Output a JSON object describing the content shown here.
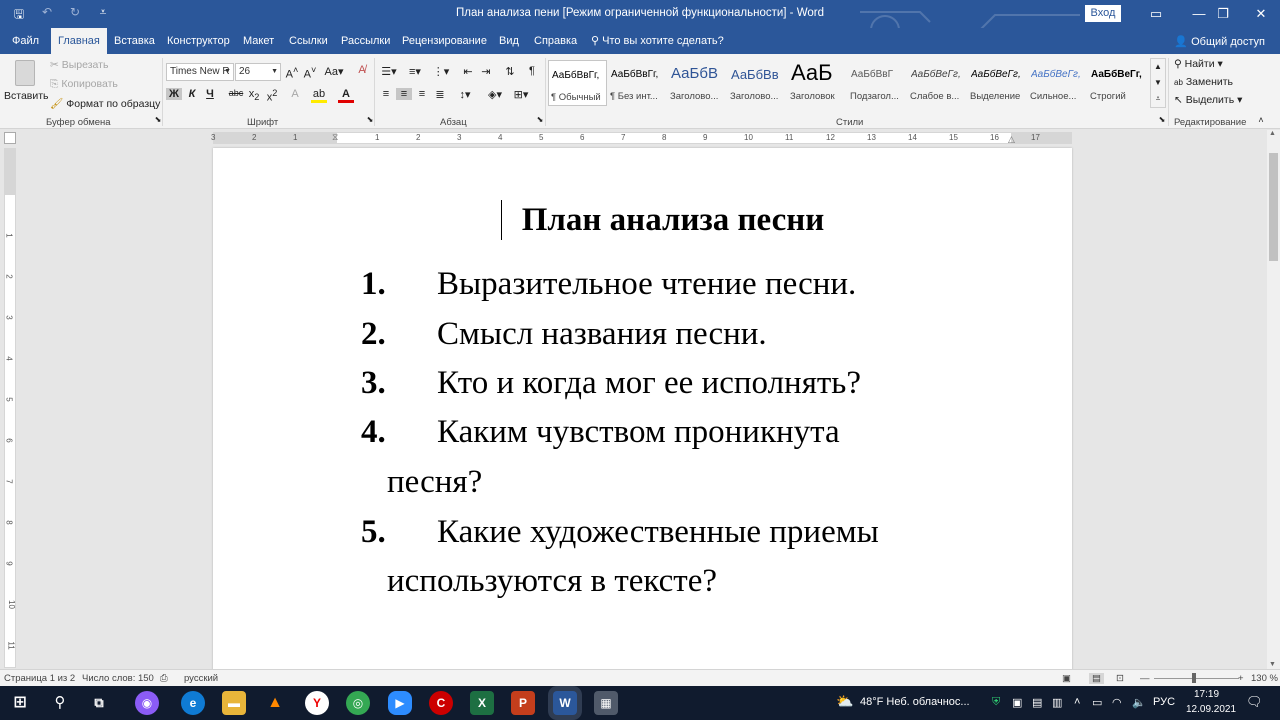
{
  "window": {
    "title": "План анализа пени [Режим ограниченной функциональности]  -  Word",
    "login_label": "Вход",
    "qat_icons": [
      "save-icon",
      "undo-icon",
      "redo-icon",
      "customize-icon"
    ]
  },
  "tabs": [
    "Файл",
    "Главная",
    "Вставка",
    "Конструктор",
    "Макет",
    "Ссылки",
    "Рассылки",
    "Рецензирование",
    "Вид",
    "Справка"
  ],
  "tell_me": "Что вы хотите сделать?",
  "share_label": "Общий доступ",
  "clipboard": {
    "paste_label": "Вставить",
    "cut_label": "Вырезать",
    "copy_label": "Копировать",
    "format_painter_label": "Формат по образцу",
    "group_label": "Буфер обмена"
  },
  "font": {
    "name": "Times New R",
    "size": "26",
    "group_label": "Шрифт"
  },
  "paragraph": {
    "group_label": "Абзац"
  },
  "styles": {
    "group_label": "Стили",
    "items": [
      {
        "preview": "АаБбВвГг,",
        "name": "¶ Обычный"
      },
      {
        "preview": "АаБбВвГг,",
        "name": "¶ Без инт..."
      },
      {
        "preview": "АаБбВ",
        "name": "Заголово..."
      },
      {
        "preview": "АаБбВв",
        "name": "Заголово..."
      },
      {
        "preview": "АаБ",
        "name": "Заголовок"
      },
      {
        "preview": "АаБбВвГ",
        "name": "Подзагол..."
      },
      {
        "preview": "АаБбВеГг,",
        "name": "Слабое в..."
      },
      {
        "preview": "АаБбВеГг,",
        "name": "Выделение"
      },
      {
        "preview": "АаБбВеГг,",
        "name": "Сильное..."
      },
      {
        "preview": "АаБбВеГг,",
        "name": "Строгий"
      }
    ]
  },
  "editing": {
    "find_label": "Найти",
    "replace_label": "Заменить",
    "select_label": "Выделить",
    "group_label": "Редактирование"
  },
  "document": {
    "title": "План анализа песни",
    "items": [
      {
        "num": "1.",
        "text": "Выразительное чтение песни."
      },
      {
        "num": "2.",
        "text": "Смысл названия песни."
      },
      {
        "num": "3.",
        "text": "Кто и когда мог ее исполнять?"
      },
      {
        "num": "4.",
        "text": "Каким чувством проникнута",
        "cont": "песня?"
      },
      {
        "num": "5.",
        "text": "Какие художественные приемы",
        "cont": "используются в тексте?"
      }
    ]
  },
  "status": {
    "page": "Страница 1 из 2",
    "words": "Число слов: 150",
    "language": "русский",
    "zoom": "130 %"
  },
  "taskbar": {
    "weather": "48°F  Неб. облачнос...",
    "lang": "РУС",
    "time": "17:19",
    "date": "12.09.2021"
  }
}
